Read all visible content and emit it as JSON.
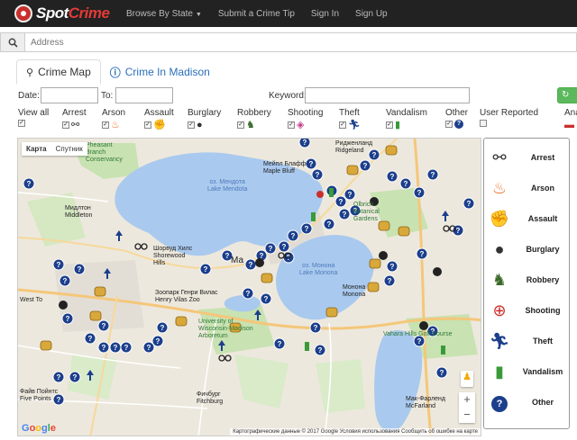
{
  "brand": {
    "spot": "Spot",
    "crime": "Crime"
  },
  "nav": [
    "Browse By State",
    "Submit a Crime Tip",
    "Sign In",
    "Sign Up"
  ],
  "search": {
    "placeholder": "Address"
  },
  "tabs": {
    "crime_map": "Crime Map",
    "crime_in": "Crime In Madison"
  },
  "filters_row": {
    "date_label": "Date:",
    "to_label": "To:",
    "keyword_label": "Keyword:"
  },
  "filters": {
    "view_all": "View all",
    "arrest": "Arrest",
    "arson": "Arson",
    "assault": "Assault",
    "burglary": "Burglary",
    "robbery": "Robbery",
    "shooting": "Shooting",
    "theft": "Theft",
    "vandalism": "Vandalism",
    "other": "Other",
    "user_reported": "User Reported",
    "ana": "Ana"
  },
  "map": {
    "type_map": "Карта",
    "type_sat": "Спутник",
    "attribution": "Картографические данные © 2017 Google   Условия использования   Сообщить об ошибке на карте",
    "labels": {
      "lake_mendota": "оз. Мендота\nLake Mendota",
      "lake_monona": "оз. Монона\nLake Monona",
      "middleton": "Мидлтон\nMiddleton",
      "maple_bluff": "Мейпл Блафф\nMaple Bluff",
      "pheasant": "Pheasant\nBranch\nConservancy",
      "shorewood": "Шорвуд Хилс\nShorewood\nHills",
      "west_town": "West To",
      "zoo": "Зоопарк Генри Вилас\nHenry Vilas Zoo",
      "uw": "University of\nWisconsin-Madison\nArboretum",
      "monona": "Монона\nMonona",
      "five_points": "Файв Пойнтс\nFive Points",
      "fitchburg": "Фичбург\nFitchburg",
      "mcfarland": "Мак-Фарленд\nMcFarland",
      "ridgeland": "Ридженланд\nRidgeland",
      "olbrich": "Olbrich\nBotanical\nGardens",
      "vahara": "Vahara Hills Golf Course",
      "madison": "Ма"
    }
  },
  "legend": [
    "Arrest",
    "Arson",
    "Assault",
    "Burglary",
    "Robbery",
    "Shooting",
    "Theft",
    "Vandalism",
    "Other"
  ],
  "colors": {
    "brand_red": "#e23b36",
    "nav_bg": "#222222",
    "other_marker": "#1c3f8c",
    "lake": "#a9c9ee",
    "park": "#c8e2b2"
  }
}
